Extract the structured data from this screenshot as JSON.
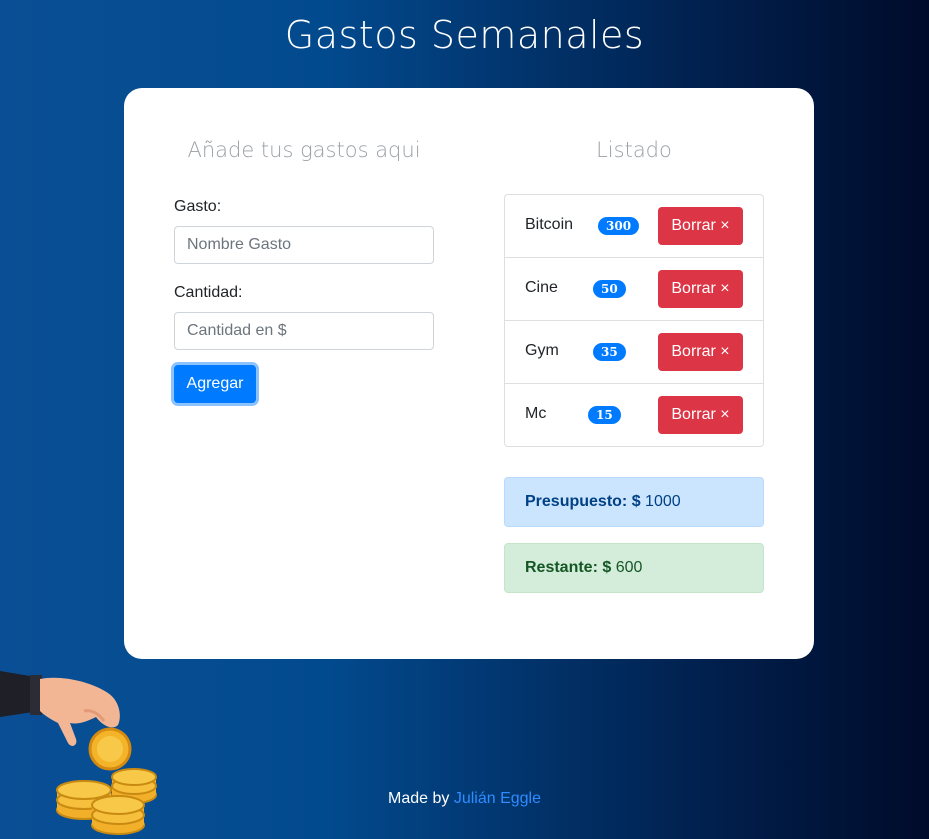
{
  "header": {
    "title": "Gastos Semanales"
  },
  "form": {
    "title": "Añade tus gastos aqui",
    "expense_label": "Gasto:",
    "expense_placeholder": "Nombre Gasto",
    "amount_label": "Cantidad:",
    "amount_placeholder": "Cantidad en $",
    "submit_label": "Agregar"
  },
  "list": {
    "title": "Listado",
    "delete_label": "Borrar ×",
    "items": [
      {
        "name": "Bitcoin",
        "amount": "300"
      },
      {
        "name": "Cine",
        "amount": "50"
      },
      {
        "name": "Gym",
        "amount": "35"
      },
      {
        "name": "Mc",
        "amount": "15"
      }
    ]
  },
  "budget": {
    "budget_label": "Presupuesto: $",
    "budget_value": "1000",
    "remaining_label": "Restante: $",
    "remaining_value": "600"
  },
  "footer": {
    "prefix": "Made by",
    "author": "Julián Eggle"
  },
  "colors": {
    "primary": "#007bff",
    "danger": "#dc3545",
    "info_bg": "#cce5ff",
    "success_bg": "#d4edda"
  }
}
